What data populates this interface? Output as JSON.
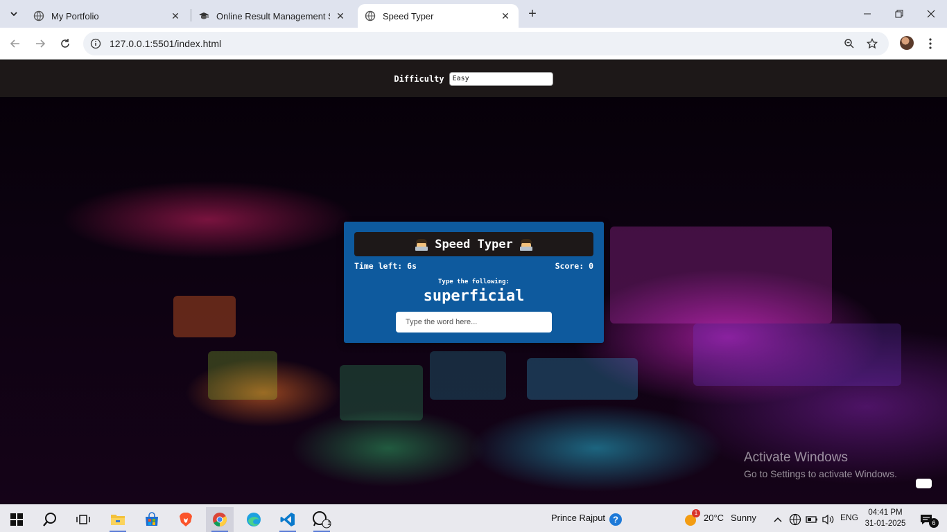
{
  "browser": {
    "tabs": [
      {
        "title": "My Portfolio",
        "favicon": "globe-icon"
      },
      {
        "title": "Online Result Management Syst",
        "favicon": "graduation-cap-icon"
      },
      {
        "title": "Speed Typer",
        "favicon": "globe-icon",
        "active": true
      }
    ],
    "url": "127.0.0.1:5501/index.html"
  },
  "settings": {
    "difficulty_label": "Difficulty",
    "difficulty_value": "Easy"
  },
  "game": {
    "title": "Speed Typer",
    "time_left": "Time left: 6s",
    "score": "Score: 0",
    "prompt": "Type the following:",
    "word": "superficial",
    "input_placeholder": "Type the word here..."
  },
  "watermark": {
    "line1": "Activate Windows",
    "line2": "Go to Settings to activate Windows."
  },
  "taskbar": {
    "user": "Prince Rajput",
    "weather_badge": "1",
    "temperature": "20°C",
    "condition": "Sunny",
    "language": "ENG",
    "time": "04:41 PM",
    "date": "31-01-2025",
    "notifications": "6",
    "whatsapp_badge": "1"
  },
  "colors": {
    "game_panel": "#0e5a9e",
    "header_dark": "#1d1818",
    "tabstrip": "#dfe3ee"
  }
}
